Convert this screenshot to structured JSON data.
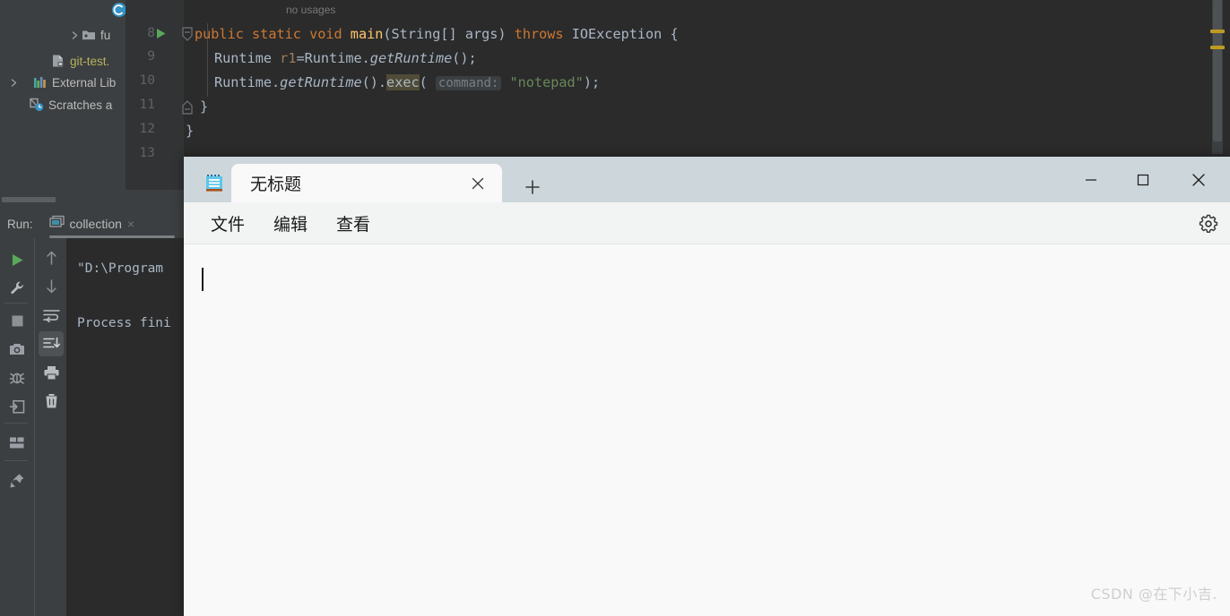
{
  "ide": {
    "project_tree": [
      {
        "label": "fu",
        "icon": "folder-icon",
        "has_arrow": true
      },
      {
        "label": "git-test.",
        "icon": "module-icon",
        "has_arrow": false
      },
      {
        "label": "External Lib",
        "icon": "library-icon",
        "has_arrow": true
      },
      {
        "label": "Scratches a",
        "icon": "scratches-icon",
        "has_arrow": false
      }
    ],
    "editor": {
      "line_numbers": [
        "8",
        "9",
        "10",
        "11",
        "12",
        "13"
      ],
      "usage_hint": "no usages",
      "lines": [
        {
          "indent": 0,
          "tokens": [
            {
              "t": "public",
              "c": "kw"
            },
            {
              "t": " ",
              "c": "plain"
            },
            {
              "t": "static",
              "c": "kw"
            },
            {
              "t": " ",
              "c": "plain"
            },
            {
              "t": "void",
              "c": "kw"
            },
            {
              "t": " ",
              "c": "plain"
            },
            {
              "t": "main",
              "c": "method"
            },
            {
              "t": "(",
              "c": "plain"
            },
            {
              "t": "String[] args",
              "c": "plain"
            },
            {
              "t": ") ",
              "c": "plain"
            },
            {
              "t": "throws",
              "c": "kw"
            },
            {
              "t": " IOException {",
              "c": "plain"
            }
          ]
        },
        {
          "indent": 1,
          "tokens": [
            {
              "t": "Runtime ",
              "c": "plain"
            },
            {
              "t": "r1",
              "c": "local"
            },
            {
              "t": "=Runtime.",
              "c": "plain"
            },
            {
              "t": "getRuntime",
              "c": "italic"
            },
            {
              "t": "();",
              "c": "plain"
            }
          ]
        },
        {
          "indent": 1,
          "tokens": [
            {
              "t": "Runtime.",
              "c": "plain"
            },
            {
              "t": "getRuntime",
              "c": "italic"
            },
            {
              "t": "().",
              "c": "plain"
            },
            {
              "t": "exec",
              "c": "hl"
            },
            {
              "t": "( ",
              "c": "plain"
            },
            {
              "t": "command:",
              "c": "hint"
            },
            {
              "t": " ",
              "c": "plain"
            },
            {
              "t": "\"notepad\"",
              "c": "str"
            },
            {
              "t": ");",
              "c": "plain"
            }
          ]
        },
        {
          "indent": 1,
          "tokens": [
            {
              "t": "}",
              "c": "plain"
            }
          ]
        },
        {
          "indent": 0,
          "tokens": [
            {
              "t": "}",
              "c": "plain"
            }
          ]
        }
      ]
    },
    "run_panel": {
      "title": "Run:",
      "tab_label": "collection",
      "tab_close": "×",
      "console_lines": [
        "\"D:\\Program",
        "Process fini"
      ],
      "toolbar_left": [
        "rerun-icon",
        "settings-wrench-icon",
        "stop-icon",
        "screenshot-camera-icon",
        "debug-icon",
        "export-icon",
        "layout-icon",
        "pin-icon"
      ],
      "toolbar_right": [
        "up-arrow-icon",
        "down-arrow-icon",
        "soft-wrap-icon",
        "scroll-to-end-icon",
        "print-icon",
        "trash-icon"
      ]
    }
  },
  "notepad": {
    "app_icon": "notepad-icon",
    "tab": {
      "title": "无标题",
      "close": "✕"
    },
    "new_tab": "+",
    "window_controls": {
      "minimize": "—",
      "maximize": "▢",
      "close": "✕"
    },
    "menu": [
      "文件",
      "编辑",
      "查看"
    ],
    "settings_icon": "gear-icon",
    "text_content": ""
  },
  "watermark": "CSDN @在下小吉.",
  "colors": {
    "ide_bg": "#3c3f41",
    "editor_bg": "#2b2b2b",
    "keyword": "#cc7832",
    "string": "#6a8759",
    "method": "#ffc66d",
    "default_text": "#a9b7c6",
    "notepad_titlebar": "#cdd7db",
    "notepad_body": "#f9f9f9",
    "marker": "#bd9b20"
  }
}
